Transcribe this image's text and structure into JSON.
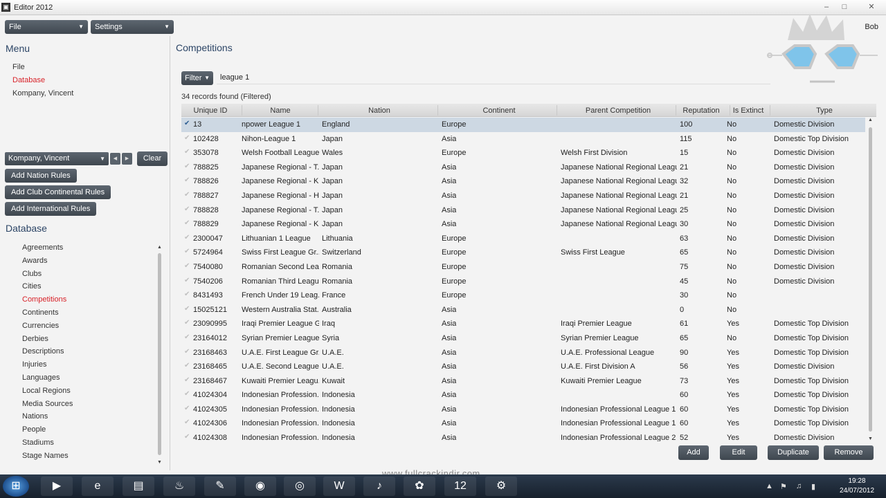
{
  "window": {
    "title": "Editor 2012",
    "icon": "fm-icon",
    "controls": [
      "minimize-icon",
      "maximize-icon",
      "close-icon"
    ]
  },
  "topbar": {
    "file_dropdown": "File",
    "settings_dropdown": "Settings",
    "user": "Bob"
  },
  "menu": {
    "title": "Menu",
    "items": [
      {
        "label": "File",
        "active": false
      },
      {
        "label": "Database",
        "active": true
      },
      {
        "label": "Kompany, Vincent",
        "active": false
      }
    ]
  },
  "rules_panel": {
    "combo_value": "Kompany, Vincent",
    "clear_label": "Clear",
    "buttons": [
      "Add Nation Rules",
      "Add Club Continental Rules",
      "Add International Rules"
    ]
  },
  "database": {
    "title": "Database",
    "items": [
      {
        "label": "Agreements",
        "active": false
      },
      {
        "label": "Awards",
        "active": false
      },
      {
        "label": "Clubs",
        "active": false
      },
      {
        "label": "Cities",
        "active": false
      },
      {
        "label": "Competitions",
        "active": true
      },
      {
        "label": "Continents",
        "active": false
      },
      {
        "label": "Currencies",
        "active": false
      },
      {
        "label": "Derbies",
        "active": false
      },
      {
        "label": "Descriptions",
        "active": false
      },
      {
        "label": "Injuries",
        "active": false
      },
      {
        "label": "Languages",
        "active": false
      },
      {
        "label": "Local Regions",
        "active": false
      },
      {
        "label": "Media Sources",
        "active": false
      },
      {
        "label": "Nations",
        "active": false
      },
      {
        "label": "People",
        "active": false
      },
      {
        "label": "Stadiums",
        "active": false
      },
      {
        "label": "Stage Names",
        "active": false
      }
    ]
  },
  "competitions": {
    "title": "Competitions",
    "filter_label": "Filter",
    "filter_value": "league 1",
    "records_found": "34 records found (Filtered)",
    "columns": [
      "Unique ID",
      "Name",
      "Nation",
      "Continent",
      "Parent Competition",
      "Reputation",
      "Is Extinct",
      "Type"
    ],
    "rows": [
      [
        "13",
        "npower League 1",
        "England",
        "Europe",
        "",
        "100",
        "No",
        "Domestic Division"
      ],
      [
        "102428",
        "Nihon-League 1",
        "Japan",
        "Asia",
        "",
        "115",
        "No",
        "Domestic Top Division"
      ],
      [
        "353078",
        "Welsh Football League ...",
        "Wales",
        "Europe",
        "Welsh First Division",
        "15",
        "No",
        "Domestic Division"
      ],
      [
        "788825",
        "Japanese Regional - T...",
        "Japan",
        "Asia",
        "Japanese National Regional League",
        "21",
        "No",
        "Domestic Division"
      ],
      [
        "788826",
        "Japanese Regional - K...",
        "Japan",
        "Asia",
        "Japanese National Regional League",
        "32",
        "No",
        "Domestic Division"
      ],
      [
        "788827",
        "Japanese Regional - H...",
        "Japan",
        "Asia",
        "Japanese National Regional League",
        "21",
        "No",
        "Domestic Division"
      ],
      [
        "788828",
        "Japanese Regional - T...",
        "Japan",
        "Asia",
        "Japanese National Regional League",
        "25",
        "No",
        "Domestic Division"
      ],
      [
        "788829",
        "Japanese Regional - K...",
        "Japan",
        "Asia",
        "Japanese National Regional League",
        "30",
        "No",
        "Domestic Division"
      ],
      [
        "2300047",
        "Lithuanian 1 League",
        "Lithuania",
        "Europe",
        "",
        "63",
        "No",
        "Domestic Division"
      ],
      [
        "5724964",
        "Swiss First League Gr...",
        "Switzerland",
        "Europe",
        "Swiss First League",
        "65",
        "No",
        "Domestic Division"
      ],
      [
        "7540080",
        "Romanian Second Lea...",
        "Romania",
        "Europe",
        "",
        "75",
        "No",
        "Domestic Division"
      ],
      [
        "7540206",
        "Romanian Third Leagu...",
        "Romania",
        "Europe",
        "",
        "45",
        "No",
        "Domestic Division"
      ],
      [
        "8431493",
        "French Under 19 Leag...",
        "France",
        "Europe",
        "",
        "30",
        "No",
        ""
      ],
      [
        "15025121",
        "Western Australia Stat...",
        "Australia",
        "Asia",
        "",
        "0",
        "No",
        ""
      ],
      [
        "23090995",
        "Iraqi Premier League G...",
        "Iraq",
        "Asia",
        "Iraqi Premier League",
        "61",
        "Yes",
        "Domestic Top Division"
      ],
      [
        "23164012",
        "Syrian Premier League ...",
        "Syria",
        "Asia",
        "Syrian Premier League",
        "65",
        "No",
        "Domestic Top Division"
      ],
      [
        "23168463",
        "U.A.E. First League Gr...",
        "U.A.E.",
        "Asia",
        "U.A.E. Professional League",
        "90",
        "Yes",
        "Domestic Top Division"
      ],
      [
        "23168465",
        "U.A.E. Second League ...",
        "U.A.E.",
        "Asia",
        "U.A.E. First Division A",
        "56",
        "Yes",
        "Domestic Division"
      ],
      [
        "23168467",
        "Kuwaiti Premier Leagu...",
        "Kuwait",
        "Asia",
        "Kuwaiti Premier League",
        "73",
        "Yes",
        "Domestic Top Division"
      ],
      [
        "41024304",
        "Indonesian Profession...",
        "Indonesia",
        "Asia",
        "",
        "60",
        "Yes",
        "Domestic Top Division"
      ],
      [
        "41024305",
        "Indonesian Profession...",
        "Indonesia",
        "Asia",
        "Indonesian Professional League 1",
        "60",
        "Yes",
        "Domestic Top Division"
      ],
      [
        "41024306",
        "Indonesian Profession...",
        "Indonesia",
        "Asia",
        "Indonesian Professional League 1",
        "60",
        "Yes",
        "Domestic Top Division"
      ],
      [
        "41024308",
        "Indonesian Profession...",
        "Indonesia",
        "Asia",
        "Indonesian Professional League 2",
        "52",
        "Yes",
        "Domestic Division"
      ]
    ],
    "actions": [
      "Add",
      "Edit",
      "Duplicate",
      "Remove"
    ]
  },
  "watermark": "www.fullcrackindir.com",
  "taskbar": {
    "apps": [
      "media-player-icon",
      "internet-explorer-icon",
      "folder-icon",
      "steam-icon",
      "paint-icon",
      "firefox-icon",
      "chrome-icon",
      "word-icon",
      "itunes-icon",
      "messenger-icon",
      "fm12-icon",
      "tool-icon"
    ],
    "time": "19:28",
    "date": "24/07/2012"
  },
  "colors": {
    "accent_active": "#d8232a",
    "heading": "#2c4566",
    "button": "#4a525b",
    "selected_row": "#cdd8e3"
  }
}
